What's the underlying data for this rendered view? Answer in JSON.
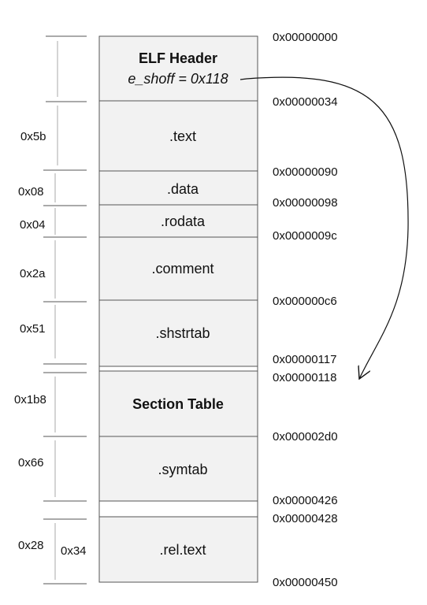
{
  "sections": [
    {
      "name": "ELF Header",
      "subtitle": "e_shoff = 0x118",
      "bold": true
    },
    {
      "name": ".text"
    },
    {
      "name": ".data"
    },
    {
      "name": ".rodata"
    },
    {
      "name": ".comment"
    },
    {
      "name": ".shstrtab"
    },
    {
      "name": "Section Table",
      "bold": true
    },
    {
      "name": ".symtab"
    },
    {
      "name": ".rel.text"
    }
  ],
  "addresses": [
    "0x00000000",
    "0x00000034",
    "0x00000090",
    "0x00000098",
    "0x0000009c",
    "0x000000c6",
    "0x00000117",
    "0x00000118",
    "0x000002d0",
    "0x00000426",
    "0x00000428",
    "0x00000450"
  ],
  "sizes": [
    "0x5b",
    "0x08",
    "0x04",
    "0x2a",
    "0x51",
    "0x1b8",
    "0x66",
    "0x28",
    "0x34"
  ],
  "arrow": {
    "from": "e_shoff",
    "to": "0x00000118"
  }
}
